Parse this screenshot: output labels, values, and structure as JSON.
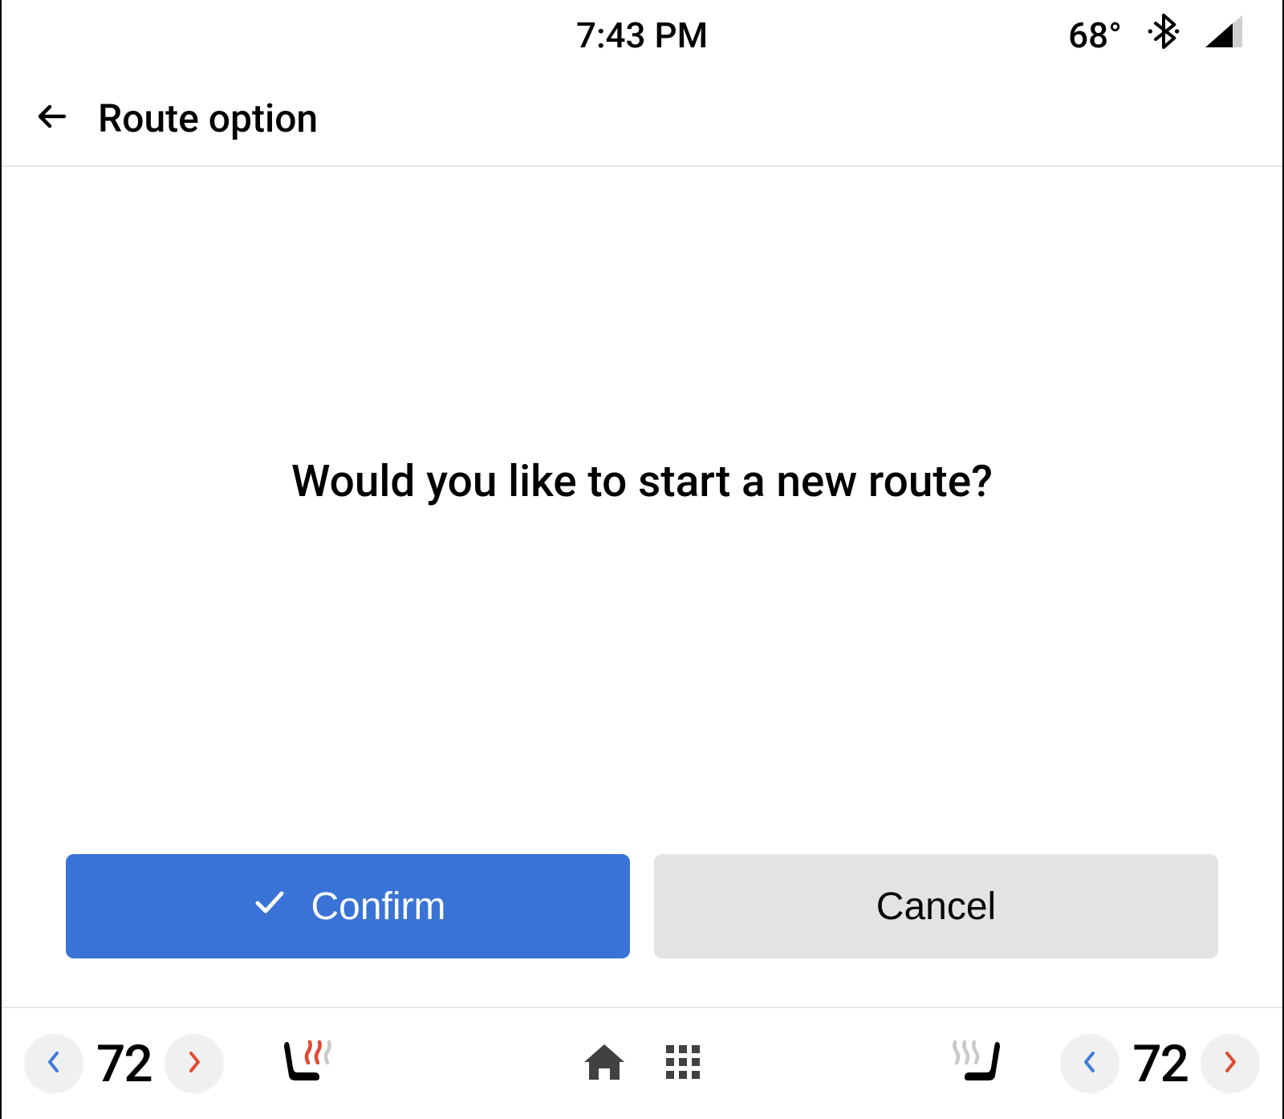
{
  "status": {
    "time": "7:43 PM",
    "temperature": "68°"
  },
  "header": {
    "title": "Route option"
  },
  "main": {
    "prompt": "Would you like to start a new route?",
    "confirm_label": "Confirm",
    "cancel_label": "Cancel"
  },
  "climate": {
    "left_temp": "72",
    "right_temp": "72"
  },
  "colors": {
    "primary": "#3973d6",
    "chevron_blue": "#3f7bdc",
    "chevron_red": "#e04a33"
  }
}
